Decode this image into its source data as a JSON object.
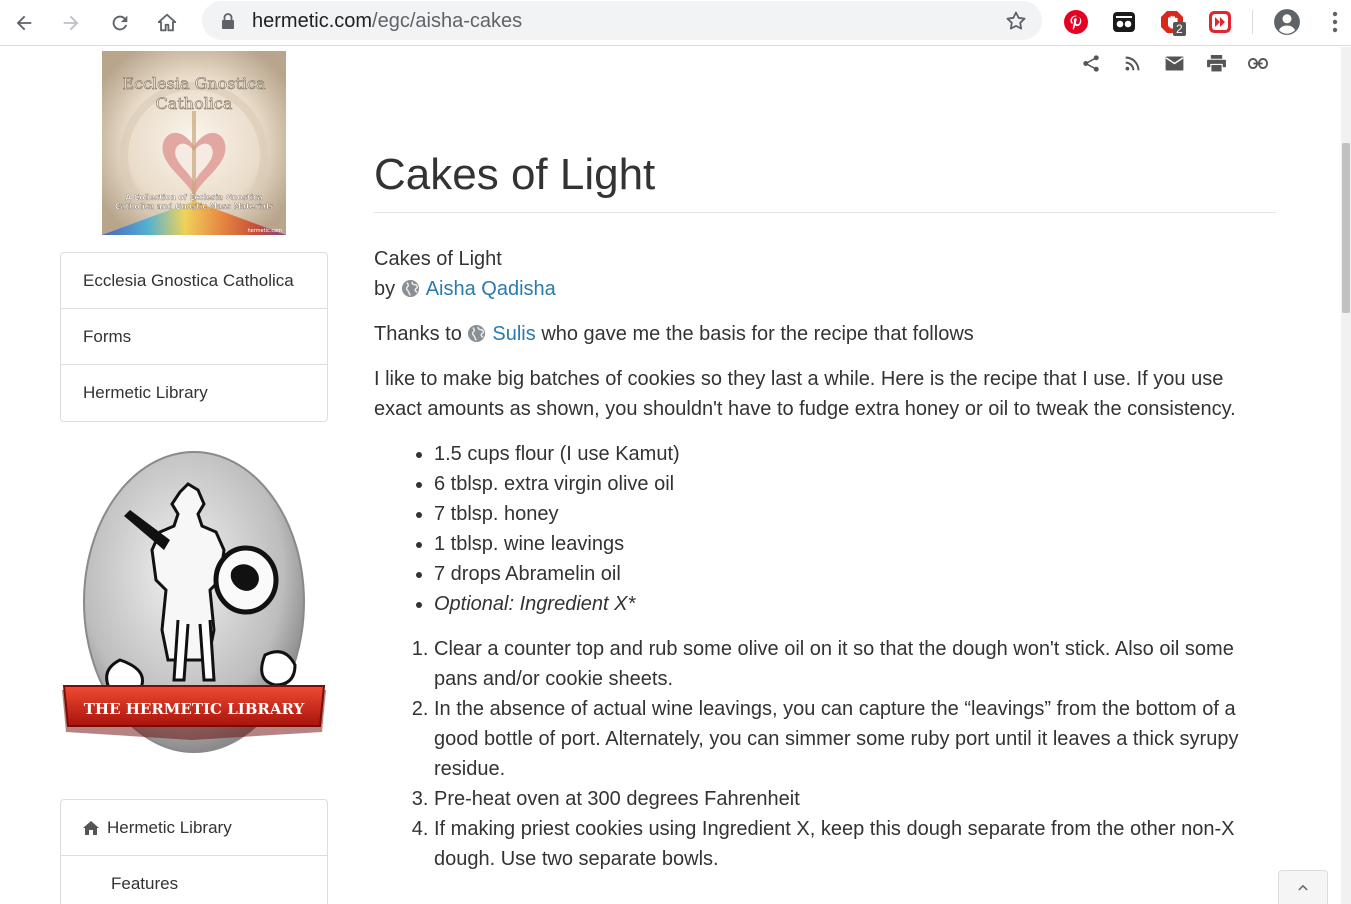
{
  "browser": {
    "url_host": "hermetic.com",
    "url_path": "/egc/aisha-cakes",
    "extension_badge": "2"
  },
  "sidebar": {
    "egc_logo": {
      "title_line1": "Ecclesia Gnostica",
      "title_line2": "Catholica",
      "caption_line1": "A Collection of Ecclesia Gnostica",
      "caption_line2": "Catholica and Gnostic Mass Materials",
      "credit": "hermetic.com"
    },
    "nav": [
      {
        "label": "Ecclesia Gnostica Catholica"
      },
      {
        "label": "Forms"
      },
      {
        "label": "Hermetic Library"
      }
    ],
    "library_logo_banner": "THE HERMETIC LIBRARY",
    "nav2": [
      {
        "label": "Hermetic Library"
      },
      {
        "label": "Features"
      }
    ]
  },
  "article": {
    "title": "Cakes of Light",
    "subtitle": "Cakes of Light",
    "by_prefix": "by",
    "author": "Aisha Qadisha",
    "thanks_prefix": "Thanks to",
    "thanks_person": "Sulis",
    "thanks_suffix": "who gave me the basis for the recipe that follows",
    "intro": "I like to make big batches of cookies so they last a while. Here is the recipe that I use. If you use exact amounts as shown, you shouldn't have to fudge extra honey or oil to tweak the consistency.",
    "ingredients": [
      "1.5 cups flour (I use Kamut)",
      "6 tblsp. extra virgin olive oil",
      "7 tblsp. honey",
      "1 tblsp. wine leavings",
      "7 drops Abramelin oil",
      "Optional: Ingredient X*"
    ],
    "steps": [
      "Clear a counter top and rub some olive oil on it so that the dough won't stick. Also oil some pans and/or cookie sheets.",
      "In the absence of actual wine leavings, you can capture the “leavings” from the bottom of a good bottle of port. Alternately, you can simmer some ruby port until it leaves a thick syrupy residue.",
      "Pre-heat oven at 300 degrees Fahrenheit",
      "If making priest cookies using Ingredient X, keep this dough separate from the other non-X dough. Use two separate bowls."
    ]
  },
  "colors": {
    "link": "#2a7ab0",
    "text": "#333333",
    "banner_red": "#d8281c"
  }
}
